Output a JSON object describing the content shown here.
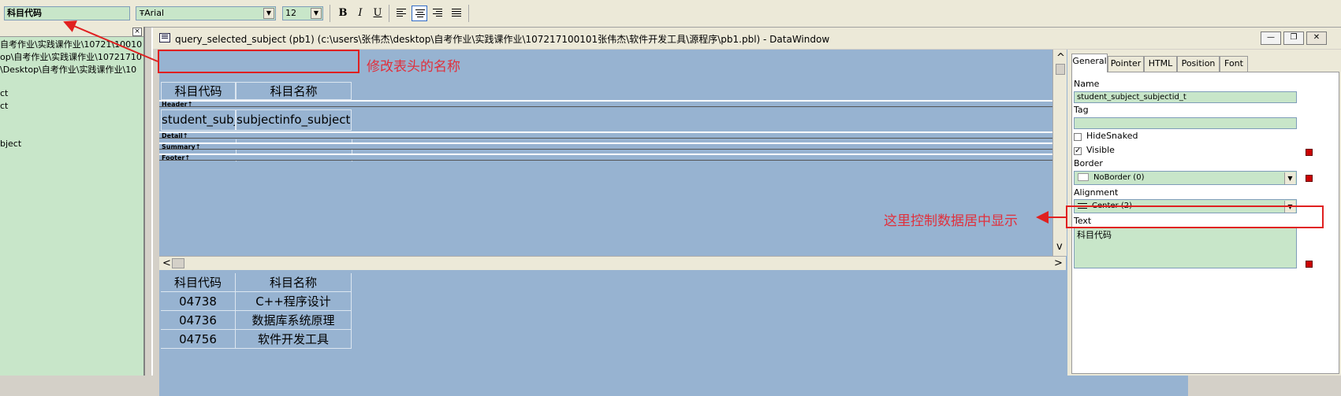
{
  "toolbar": {
    "control_value": "科目代码",
    "font_icon_glyph": "Ŧ",
    "font_name": "Arial",
    "font_size": "12",
    "bold_label": "B",
    "italic_label": "I",
    "underline_label": "U"
  },
  "library_tree": {
    "close_label": "×",
    "lines": [
      "自考作业\\实践课作业\\10721\\10010",
      "op\\自考作业\\实践课作业\\10721710",
      "\\Desktop\\自考作业\\实践课作业\\10",
      "",
      "ct",
      "ct",
      "",
      "",
      "bject"
    ]
  },
  "datawindow": {
    "title": "query_selected_subject  (pb1) (c:\\users\\张伟杰\\desktop\\自考作业\\实践课作业\\107217100101张伟杰\\软件开发工具\\源程序\\pb1.pbl) - DataWindow",
    "minimize_label": "—",
    "restore_label": "❐",
    "close_label": "✕",
    "header_cells": [
      "科目代码",
      "科目名称"
    ],
    "detail_cells": [
      "student_subject_subjectid",
      "subjectinfo_subjectname"
    ],
    "bands": [
      "Header↑",
      "Detail↑",
      "Summary↑",
      "Footer↑"
    ],
    "scroll_left": "<",
    "scroll_right": ">",
    "scroll_up": "^",
    "scroll_down": "v",
    "preview": {
      "columns": [
        "科目代码",
        "科目名称"
      ],
      "rows": [
        [
          "04738",
          "C++程序设计"
        ],
        [
          "04736",
          "数据库系统原理"
        ],
        [
          "04756",
          "软件开发工具"
        ]
      ]
    }
  },
  "properties": {
    "tabs": [
      "General",
      "Pointer",
      "HTML",
      "Position",
      "Font"
    ],
    "active_tab": "General",
    "name_label": "Name",
    "name_value": "student_subject_subjectid_t",
    "tag_label": "Tag",
    "tag_value": "",
    "hidesnaked_label": "HideSnaked",
    "hidesnaked_checked": false,
    "visible_label": "Visible",
    "visible_check_glyph": "✓",
    "visible_checked": true,
    "border_label": "Border",
    "border_value": "NoBorder (0)",
    "alignment_label": "Alignment",
    "alignment_value": "Center (2)",
    "text_label": "Text",
    "text_value": "科目代码"
  },
  "annotations": {
    "header_note": "修改表头的名称",
    "alignment_note": "这里控制数据居中显示"
  },
  "colors": {
    "annotation_red": "#e02020",
    "design_canvas": "#97b3d1",
    "field_green": "#c8e6c9"
  }
}
